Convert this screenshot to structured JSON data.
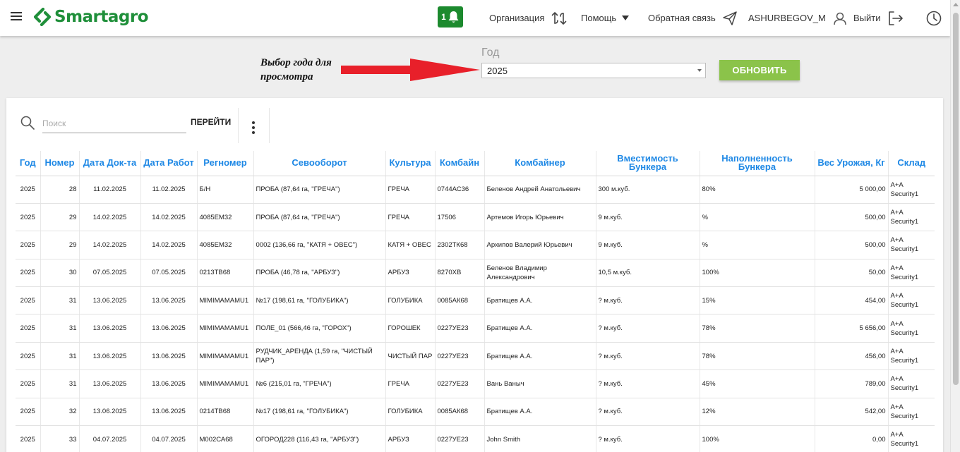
{
  "header": {
    "logo_text": "Smartagro",
    "notification_count": "1",
    "organization": "Организация",
    "help": "Помощь",
    "feedback": "Обратная связь",
    "user": "ASHURBEGOV_M",
    "logout": "Выйти",
    "accent": "#1c8a2e"
  },
  "filter": {
    "annotation_line1": "Выбор года для",
    "annotation_line2": "просмотра",
    "year_label": "Год",
    "year_value": "2025",
    "refresh_label": "ОБНОВИТЬ"
  },
  "toolbar": {
    "search_placeholder": "Поиск",
    "goto_label": "ПЕРЕЙТИ"
  },
  "table": {
    "columns": [
      "Год",
      "Номер",
      "Дата Док-та",
      "Дата Работ",
      "Регномер",
      "Севооборот",
      "Культура",
      "Комбайн",
      "Комбайнер",
      "Вместимость Бункера",
      "Наполненность Бункера",
      "Вес Урожая, Кг",
      "Склад"
    ],
    "rows": [
      [
        "2025",
        "28",
        "11.02.2025",
        "11.02.2025",
        "Б/Н",
        "ПРОБА (87,64 га, \"ГРЕЧА\")",
        "ГРЕЧА",
        "0744АС36",
        "Беленов Андрей Анатольевич",
        "300 м.куб.",
        "80%",
        "5 000,00",
        "A+A Security1"
      ],
      [
        "2025",
        "29",
        "14.02.2025",
        "14.02.2025",
        "4085ЕМ32",
        "ПРОБА (87,64 га, \"ГРЕЧА\")",
        "ГРЕЧА",
        "17506",
        "Артемов Игорь Юрьевич",
        "9 м.куб.",
        "%",
        "500,00",
        "A+A Security1"
      ],
      [
        "2025",
        "29",
        "14.02.2025",
        "14.02.2025",
        "4085ЕМ32",
        "0002 (136,66 га, \"КАТЯ + ОВЕС\")",
        "КАТЯ + ОВЕС",
        "2302ТК68",
        "Архипов Валерий Юрьевич",
        "9 м.куб.",
        "%",
        "500,00",
        "A+A Security1"
      ],
      [
        "2025",
        "30",
        "07.05.2025",
        "07.05.2025",
        "0213ТВ68",
        "ПРОБА (46,78 га, \"АРБУЗ\")",
        "АРБУЗ",
        "8270ХВ",
        "Беленов Владимир Александрович",
        "10,5 м.куб.",
        "100%",
        "50,00",
        "A+A Security1"
      ],
      [
        "2025",
        "31",
        "13.06.2025",
        "13.06.2025",
        "MIMIMAMAMU1",
        "№17 (198,61 га, \"ГОЛУБИКА\")",
        "ГОЛУБИКА",
        "0085АК68",
        "Братищев А.А.",
        "? м.куб.",
        "15%",
        "454,00",
        "A+A Security1"
      ],
      [
        "2025",
        "31",
        "13.06.2025",
        "13.06.2025",
        "MIMIMAMAMU1",
        "ПОЛЕ_01 (566,46 га, \"ГОРОХ\")",
        "ГОРОШЕК",
        "0227УЕ23",
        "Братищев А.А.",
        "? м.куб.",
        "78%",
        "5 656,00",
        "A+A Security1"
      ],
      [
        "2025",
        "31",
        "13.06.2025",
        "13.06.2025",
        "MIMIMAMAMU1",
        "РУДЧИК_АРЕНДА (1,59 га, \"ЧИСТЫЙ ПАР\")",
        "ЧИСТЫЙ ПАР",
        "0227УЕ23",
        "Братищев А.А.",
        "? м.куб.",
        "78%",
        "456,00",
        "A+A Security1"
      ],
      [
        "2025",
        "31",
        "13.06.2025",
        "13.06.2025",
        "MIMIMAMAMU1",
        "№6 (215,01 га, \"ГРЕЧА\")",
        "ГРЕЧА",
        "0227УЕ23",
        "Вань Ваныч",
        "? м.куб.",
        "45%",
        "789,00",
        "A+A Security1"
      ],
      [
        "2025",
        "32",
        "13.06.2025",
        "13.06.2025",
        "0214ТВ68",
        "№17 (198,61 га, \"ГОЛУБИКА\")",
        "ГОЛУБИКА",
        "0085АК68",
        "Братищев А.А.",
        "? м.куб.",
        "12%",
        "542,00",
        "A+A Security1"
      ],
      [
        "2025",
        "33",
        "04.07.2025",
        "04.07.2025",
        "М002СА68",
        "ОГОРОД228 (116,43 га, \"АРБУЗ\")",
        "АРБУЗ",
        "0227УЕ23",
        "John Smith",
        "? м.куб.",
        "100%",
        "0,00",
        "A+A Security1"
      ]
    ]
  }
}
